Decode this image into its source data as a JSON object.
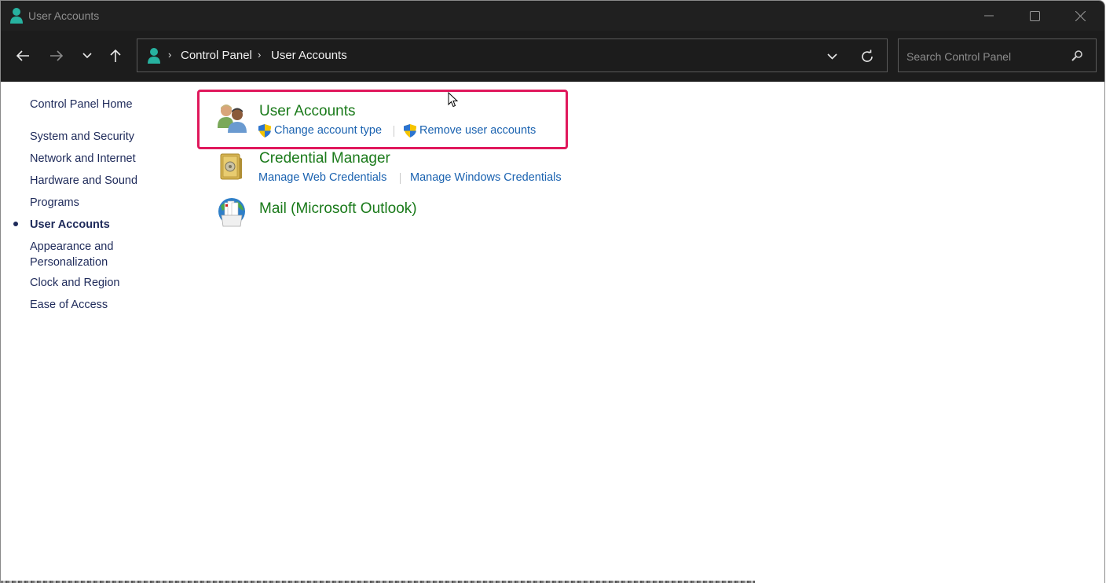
{
  "window": {
    "title": "User Accounts",
    "controls": {
      "minimize": "minimize-icon",
      "maximize": "maximize-icon",
      "close": "close-icon"
    }
  },
  "navbar": {
    "back": "back-arrow-icon",
    "forward": "forward-arrow-icon",
    "recent": "chevron-down-icon",
    "up": "up-arrow-icon",
    "breadcrumb": [
      "Control Panel",
      "User Accounts"
    ],
    "search_placeholder": "Search Control Panel",
    "search_value": ""
  },
  "sidebar": {
    "home": "Control Panel Home",
    "items": [
      {
        "label": "System and Security",
        "active": false
      },
      {
        "label": "Network and Internet",
        "active": false
      },
      {
        "label": "Hardware and Sound",
        "active": false
      },
      {
        "label": "Programs",
        "active": false
      },
      {
        "label": "User Accounts",
        "active": true
      },
      {
        "label": "Appearance and Personalization",
        "line1": "Appearance and",
        "line2": "Personalization",
        "active": false
      },
      {
        "label": "Clock and Region",
        "active": false
      },
      {
        "label": "Ease of Access",
        "active": false
      }
    ]
  },
  "categories": [
    {
      "title": "User Accounts",
      "icon": "users-icon",
      "highlighted": true,
      "links": [
        {
          "label": "Change account type",
          "shield": true
        },
        {
          "label": "Remove user accounts",
          "shield": true
        }
      ]
    },
    {
      "title": "Credential Manager",
      "icon": "safe-icon",
      "highlighted": false,
      "links": [
        {
          "label": "Manage Web Credentials",
          "shield": false
        },
        {
          "label": "Manage Windows Credentials",
          "shield": false
        }
      ]
    },
    {
      "title": "Mail (Microsoft Outlook)",
      "icon": "mail-globe-icon",
      "highlighted": false,
      "links": []
    }
  ],
  "colors": {
    "highlight_border": "#e0185c",
    "category_title": "#1a7a1a",
    "link": "#1a62b0",
    "sidebar_text": "#1e2a5a",
    "titlebar_bg": "#202020",
    "navbar_bg": "#1c1c1c",
    "accent_icon": "#27b2a0"
  }
}
